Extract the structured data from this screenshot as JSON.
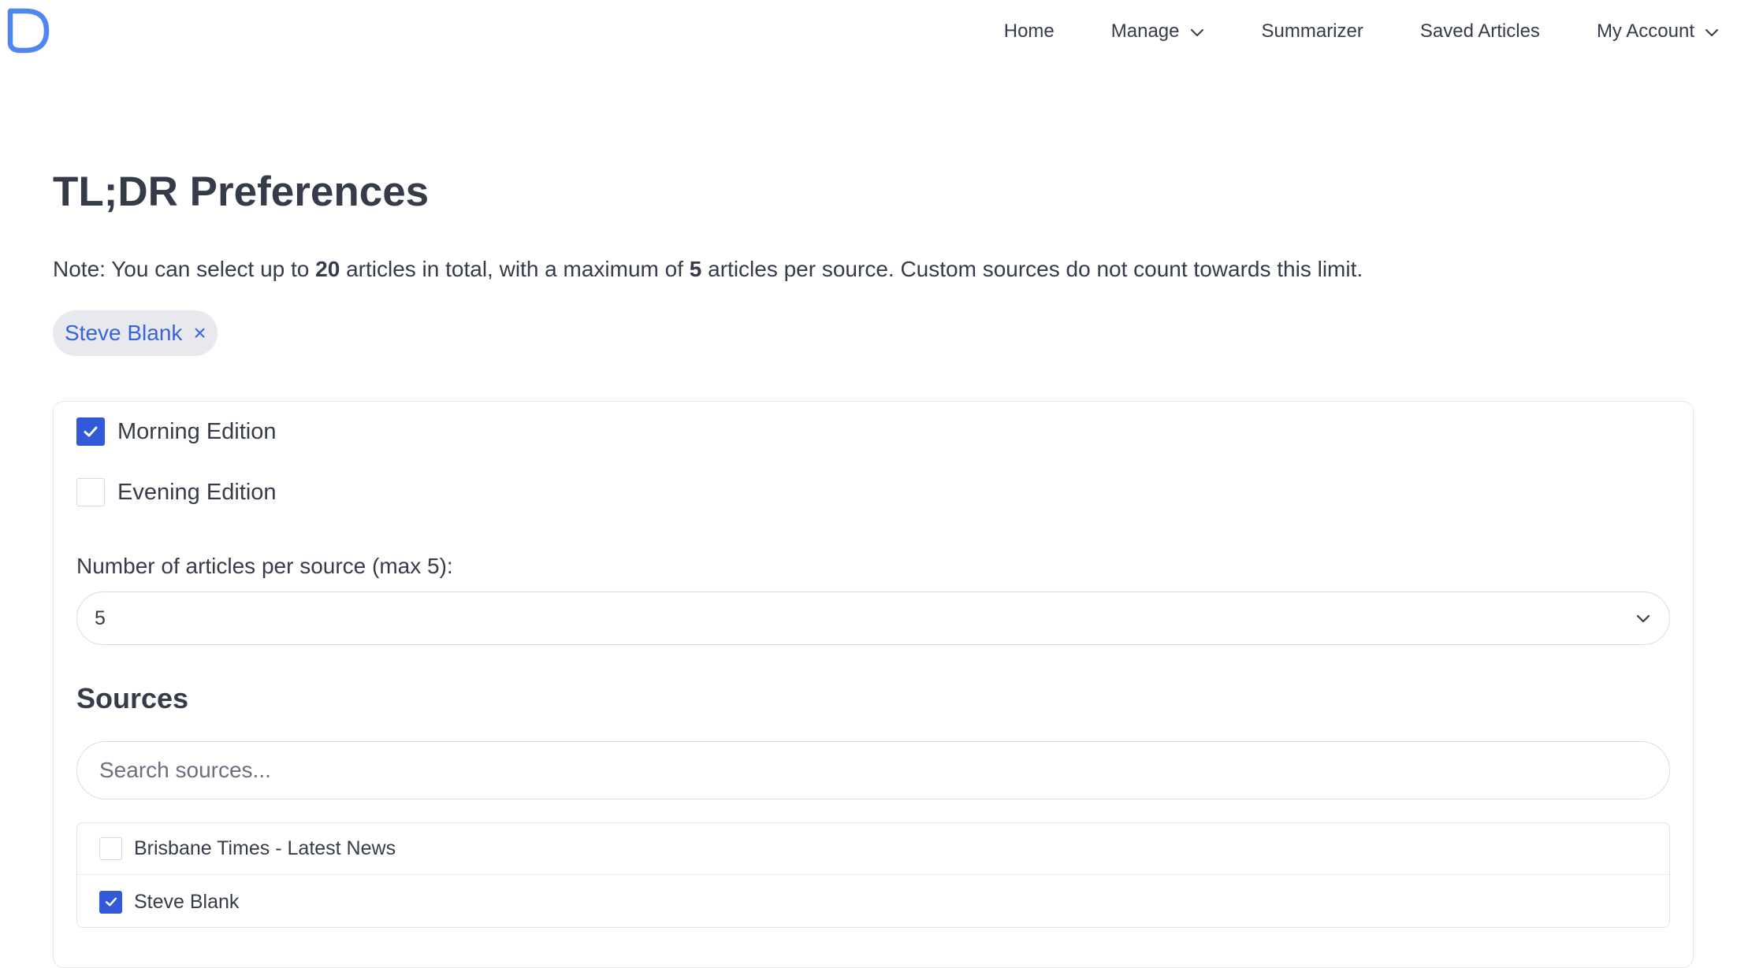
{
  "nav": {
    "logo_icon": "d-logo-icon",
    "items": [
      {
        "label": "Home",
        "has_dropdown": false
      },
      {
        "label": "Manage",
        "has_dropdown": true
      },
      {
        "label": "Summarizer",
        "has_dropdown": false
      },
      {
        "label": "Saved Articles",
        "has_dropdown": false
      },
      {
        "label": "My Account",
        "has_dropdown": true
      }
    ]
  },
  "page": {
    "title": "TL;DR Preferences",
    "note": {
      "prefix": "Note: You can select up to ",
      "total_limit": "20",
      "middle": " articles in total, with a maximum of ",
      "per_source_limit": "5",
      "suffix": " articles per source. Custom sources do not count towards this limit."
    },
    "selected_chip": {
      "label": "Steve Blank",
      "remove_symbol": "×"
    }
  },
  "preferences": {
    "editions": [
      {
        "label": "Morning Edition",
        "checked": true
      },
      {
        "label": "Evening Edition",
        "checked": false
      }
    ],
    "articles_per_source": {
      "label": "Number of articles per source (max 5):",
      "selected_value": "5"
    },
    "sources": {
      "title": "Sources",
      "search_placeholder": "Search sources...",
      "items": [
        {
          "label": "Brisbane Times - Latest News",
          "checked": false
        },
        {
          "label": "Steve Blank",
          "checked": true
        }
      ]
    }
  },
  "colors": {
    "accent": "#3159d8",
    "link": "#3a63d8",
    "text": "#363b4a",
    "chip_bg": "#e8e9ee",
    "logo": "#4f86f0"
  }
}
